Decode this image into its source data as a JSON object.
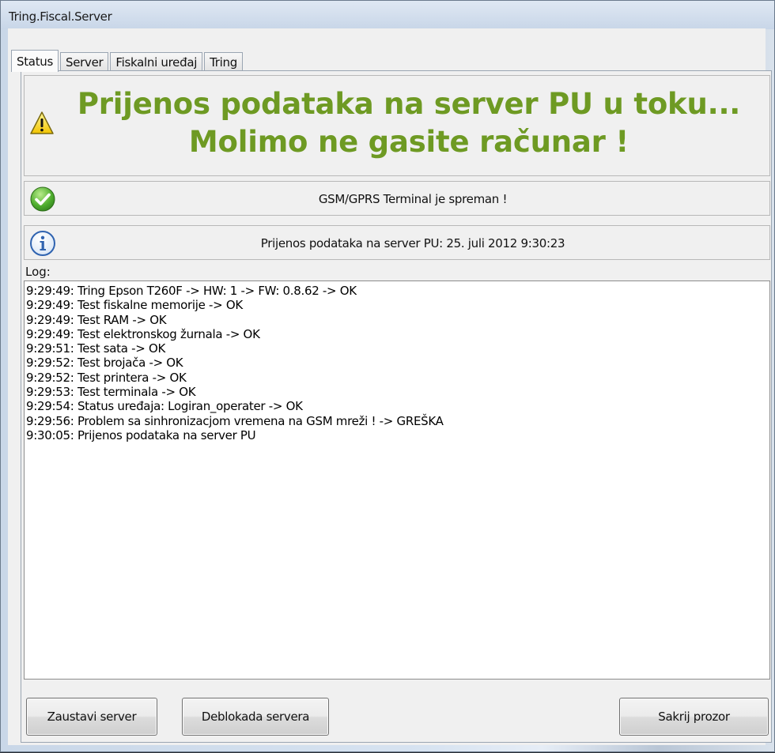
{
  "window": {
    "title": "Tring.Fiscal.Server"
  },
  "tabs": [
    {
      "label": "Status",
      "active": true
    },
    {
      "label": "Server",
      "active": false
    },
    {
      "label": "Fiskalni uređaj",
      "active": false
    },
    {
      "label": "Tring",
      "active": false
    }
  ],
  "banner": {
    "icon": "warning-icon",
    "line1": "Prijenos podataka na server PU u toku...",
    "line2": "Molimo ne gasite računar !",
    "color": "#6e9a23"
  },
  "status_rows": {
    "gsm": {
      "icon": "check-icon",
      "text": "GSM/GPRS Terminal je spreman !"
    },
    "transfer": {
      "icon": "info-icon",
      "text": "Prijenos podataka na server PU: 25. juli 2012 9:30:23"
    }
  },
  "log": {
    "label": "Log:",
    "lines": [
      "9:29:49: Tring Epson T260F -> HW: 1 -> FW: 0.8.62 -> OK",
      "9:29:49: Test fiskalne memorije -> OK",
      "9:29:49: Test RAM -> OK",
      "9:29:49: Test elektronskog žurnala -> OK",
      "9:29:51: Test sata -> OK",
      "9:29:52: Test brojača -> OK",
      "9:29:52: Test printera -> OK",
      "9:29:53: Test terminala -> OK",
      "9:29:54: Status uređaja: Logiran_operater -> OK",
      "9:29:56: Problem sa sinhronizacjom vremena na GSM mreži ! -> GREŠKA",
      "9:30:05: Prijenos podataka na server PU"
    ]
  },
  "buttons": {
    "stop": "Zaustavi server",
    "unblock": "Deblokada servera",
    "hide": "Sakrij prozor"
  }
}
